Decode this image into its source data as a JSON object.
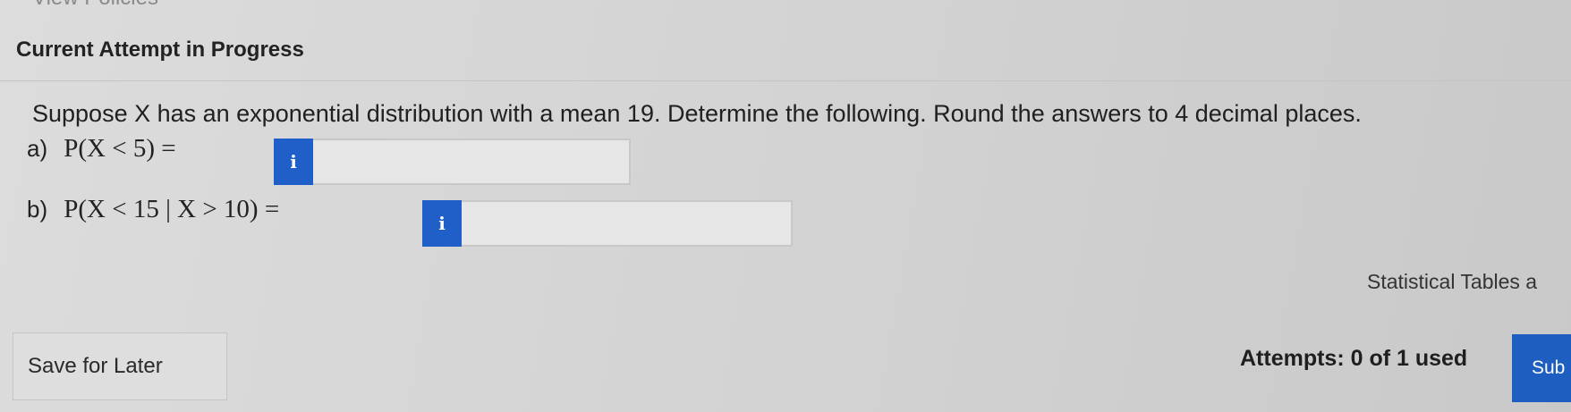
{
  "header": {
    "top_link": "View Policies",
    "section_title": "Current Attempt in Progress"
  },
  "question": {
    "text": "Suppose X has an exponential distribution with a mean 19. Determine the following. Round the answers to 4 decimal places.",
    "parts": [
      {
        "letter": "a)",
        "expression": "P(X < 5) =",
        "info_glyph": "i",
        "value": ""
      },
      {
        "letter": "b)",
        "expression": "P(X < 15 | X > 10) =",
        "info_glyph": "i",
        "value": ""
      }
    ]
  },
  "links": {
    "statistical_tables": "Statistical Tables a"
  },
  "footer": {
    "save_label": "Save for Later",
    "attempts_text": "Attempts: 0 of 1 used",
    "submit_label": "Sub"
  },
  "colors": {
    "accent": "#1f5fc7",
    "background": "#d6d6d6"
  },
  "icons": {
    "info": "info-icon"
  }
}
